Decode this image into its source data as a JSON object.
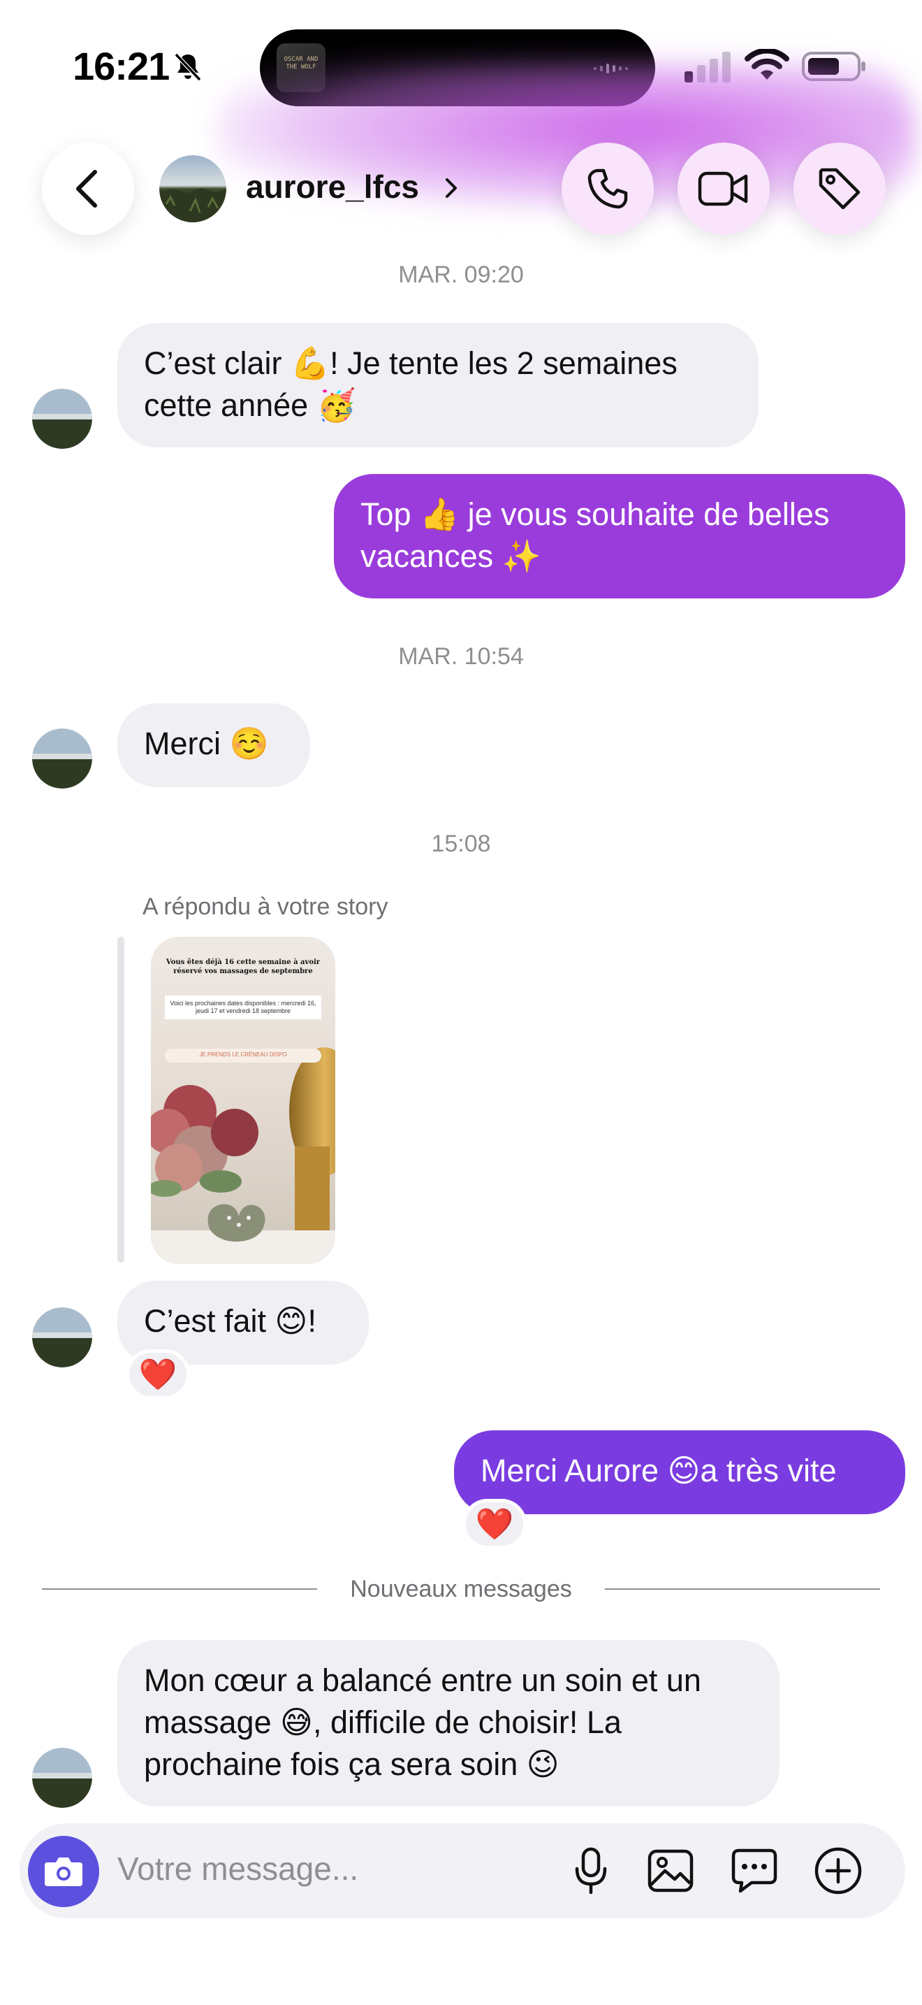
{
  "status_bar": {
    "time": "16:21",
    "island_art_text": "OSCAR AND THE WOLF"
  },
  "header": {
    "username": "aurore_lfcs",
    "icons": [
      "back-arrow-icon",
      "phone-icon",
      "video-camera-icon",
      "tag-icon"
    ],
    "accent_color": "#c44ce6"
  },
  "chat": {
    "timestamps": [
      "MAR. 09:20",
      "MAR. 10:54",
      "15:08"
    ],
    "messages": [
      {
        "from": "them",
        "text": "C’est clair 💪! Je tente les 2 semaines",
        "text2": "cette année 🥳"
      },
      {
        "from": "me",
        "text": "Top 👍 je vous souhaite de belles",
        "text2": "vacances ✨"
      },
      {
        "from": "them",
        "text": "Merci ☺️"
      },
      {
        "from": "them",
        "text": "C’est fait 😊!",
        "reaction": "❤️"
      },
      {
        "from": "me",
        "text": "Merci Aurore 😊a très vite",
        "reaction": "❤️"
      },
      {
        "from": "them",
        "text": "Mon cœur a balancé entre un soin et un",
        "text2": "massage 😅, difficile de choisir! La",
        "text3": "prochaine fois ça sera soin 😉"
      }
    ],
    "story_reply": {
      "label": "A répondu à votre story",
      "story_title": "Vous êtes déjà 16 cette semaine à avoir réservé vos massages de septembre",
      "story_dates": "Voici les prochaines dates disponibles : mercredi 16, jeudi 17 et vendredi 18 septembre",
      "story_tag": "JE PRENDS LE CRÉNEAU DISPO"
    },
    "new_messages_divider": "Nouveaux messages"
  },
  "composer": {
    "placeholder": "Votre message...",
    "icons": [
      "camera-icon",
      "microphone-icon",
      "gallery-icon",
      "sticker-chat-icon",
      "add-icon"
    ],
    "camera_color": "#5b51de"
  },
  "colors": {
    "incoming_bubble": "#efeff4",
    "outgoing_bubble": "#9a3cdb",
    "outgoing_bubble_2": "#7a3ce0"
  }
}
